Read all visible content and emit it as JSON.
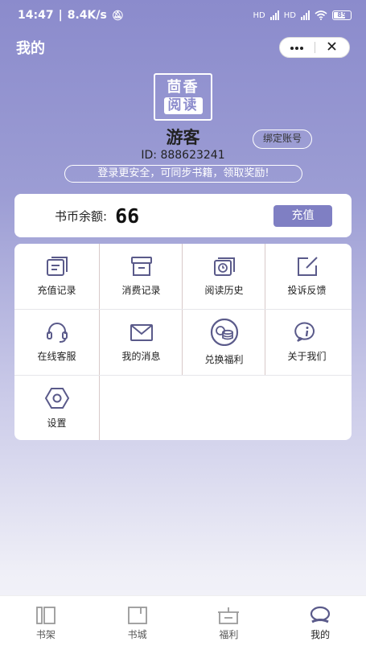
{
  "status": {
    "time": "14:47",
    "speed": "8.4K/s",
    "net1": "HD",
    "net2": "HD",
    "battery": "85"
  },
  "header": {
    "title": "我的"
  },
  "profile": {
    "logo_top": "茴香",
    "logo_bottom": "阅读",
    "username": "游客",
    "bind_label": "绑定账号",
    "user_id": "ID: 888623241",
    "login_tip": "登录更安全，可同步书籍，领取奖励!"
  },
  "balance": {
    "label": "书币余额:",
    "value": "66",
    "recharge_label": "充值"
  },
  "menu": {
    "items": [
      {
        "label": "充值记录",
        "icon": "recharge-record-icon"
      },
      {
        "label": "消费记录",
        "icon": "consume-record-icon"
      },
      {
        "label": "阅读历史",
        "icon": "reading-history-icon"
      },
      {
        "label": "投诉反馈",
        "icon": "feedback-icon"
      },
      {
        "label": "在线客服",
        "icon": "headset-icon"
      },
      {
        "label": "我的消息",
        "icon": "mail-icon"
      },
      {
        "label": "兑换福利",
        "icon": "coins-icon"
      },
      {
        "label": "关于我们",
        "icon": "info-icon"
      },
      {
        "label": "设置",
        "icon": "settings-icon"
      }
    ]
  },
  "nav": {
    "items": [
      {
        "label": "书架",
        "icon": "bookshelf-icon"
      },
      {
        "label": "书城",
        "icon": "bookstore-icon"
      },
      {
        "label": "福利",
        "icon": "welfare-icon"
      },
      {
        "label": "我的",
        "icon": "profile-icon"
      }
    ],
    "active_index": 3
  },
  "colors": {
    "accent": "#7f7fc3",
    "header_bg": "#8b8bcc",
    "icon": "#5a5a8a"
  }
}
